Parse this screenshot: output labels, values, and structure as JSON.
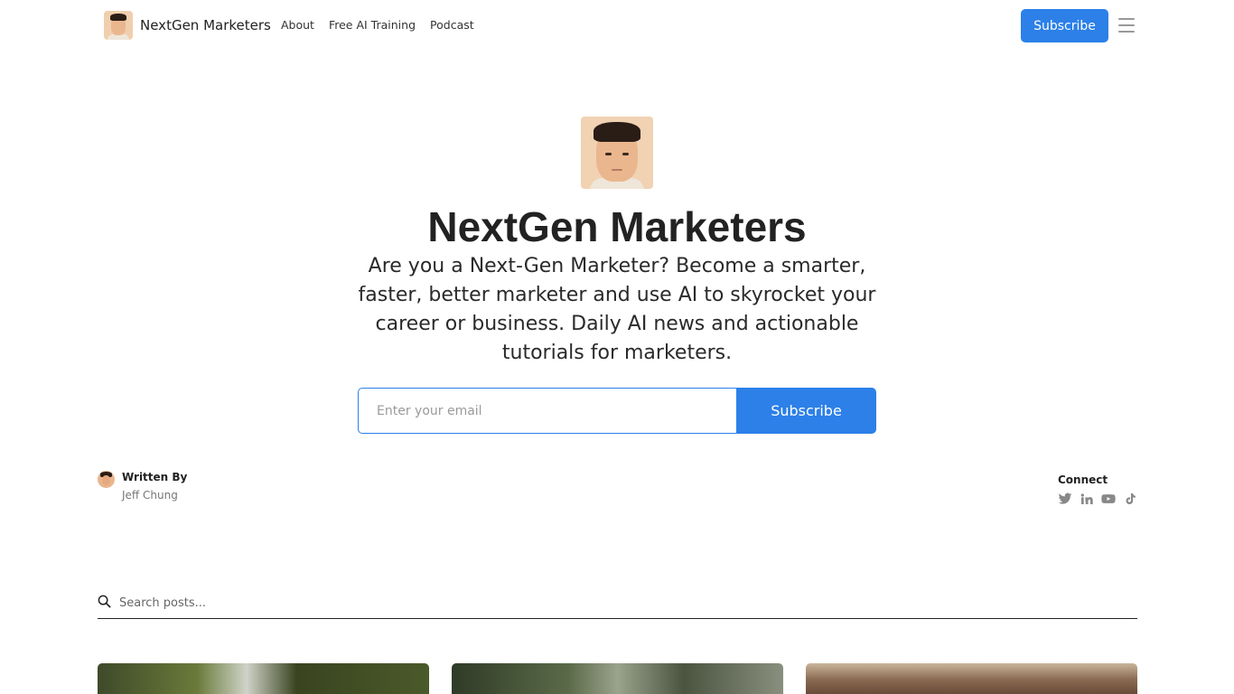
{
  "header": {
    "brand": "NextGen Marketers",
    "nav": [
      "About",
      "Free AI Training",
      "Podcast"
    ],
    "subscribe_label": "Subscribe"
  },
  "hero": {
    "title": "NextGen Marketers",
    "description": "Are you a Next-Gen Marketer? Become a smarter, faster, better marketer and use AI to skyrocket your career or business. Daily AI news and actionable tutorials for marketers.",
    "email_placeholder": "Enter your email",
    "subscribe_label": "Subscribe"
  },
  "author": {
    "label": "Written By",
    "name": "Jeff Chung"
  },
  "connect": {
    "label": "Connect",
    "icons": [
      "twitter-icon",
      "linkedin-icon",
      "youtube-icon",
      "tiktok-icon"
    ]
  },
  "search": {
    "placeholder": "Search posts..."
  },
  "colors": {
    "accent": "#2c80e8",
    "text": "#222222",
    "icon_gray": "#888888"
  }
}
